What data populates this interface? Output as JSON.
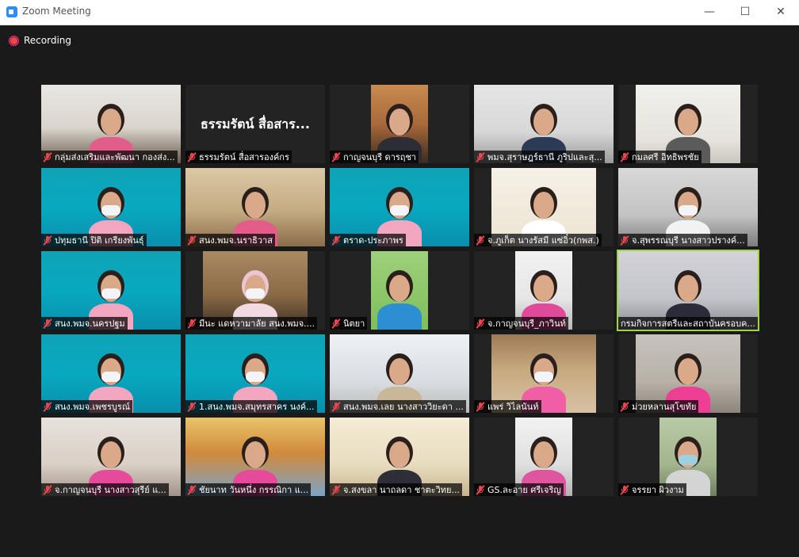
{
  "window": {
    "title": "Zoom Meeting",
    "minimize_glyph": "—",
    "maximize_glyph": "☐",
    "close_glyph": "✕"
  },
  "recording": {
    "label": "Recording",
    "indicator_color": "#e8474d"
  },
  "colors": {
    "background": "#1a1a1a",
    "muted_mic": "#e8474d",
    "active_speaker_border": "#9fd34b",
    "zoom_blue": "#2d8cff"
  },
  "participants": [
    {
      "name": "กลุ่มส่งเสริมและพัฒนา กองส่ง...",
      "muted": true,
      "video": "office-group"
    },
    {
      "name": "ธรรมรัตน์ สื่อสารองค์กร",
      "muted": true,
      "video": "none",
      "display_name": "ธรรมรัตน์ สื่อสาร..."
    },
    {
      "name": "กาญจนบุรี ดารฤชา",
      "muted": true,
      "video": "woman-room"
    },
    {
      "name": "พมจ.สุราษฎร์ธานี ภูริปและสุ...",
      "muted": true,
      "video": "man-office"
    },
    {
      "name": "กมลศรี อิทธิพรชัย",
      "muted": true,
      "video": "woman-desk"
    },
    {
      "name": "ปทุมธานี ปิติ เกรียงพันธุ์",
      "muted": true,
      "video": "teal-background"
    },
    {
      "name": "สนง.พมจ.นราธิวาส",
      "muted": true,
      "video": "meeting-room"
    },
    {
      "name": "ตราด-ประภาพร",
      "muted": true,
      "video": "teal-background"
    },
    {
      "name": "จ.ภูเก็ต นางรัสมี แซ่อิ๋ว(กพส.)",
      "muted": true,
      "video": "woman-white"
    },
    {
      "name": "จ.สุพรรณบุรี นางสาวปรางค์...",
      "muted": true,
      "video": "woman-office"
    },
    {
      "name": "สนง.พมจ.นครปฐม",
      "muted": true,
      "video": "teal-background"
    },
    {
      "name": "มีนะ แดหวามาลัย สนง.พมจ....",
      "muted": true,
      "video": "woman-hijab"
    },
    {
      "name": "นิตยา",
      "muted": true,
      "video": "man-shirt"
    },
    {
      "name": "จ.กาญจนบุรี_ภาวินท์",
      "muted": true,
      "video": "man-pink"
    },
    {
      "name": "กรมกิจการสตรีและสถาบันครอบค...",
      "muted": false,
      "video": "hall",
      "active": true
    },
    {
      "name": "สนง.พมจ.เพชรบูรณ์",
      "muted": true,
      "video": "teal-background"
    },
    {
      "name": "1.สนง.พมจ.สมุทรสาคร นงค์...",
      "muted": true,
      "video": "teal-background"
    },
    {
      "name": "สนง.พมจ.เลย นางสาววิยะดา ...",
      "muted": true,
      "video": "room-wall"
    },
    {
      "name": "แพร่ วิไลนันท์",
      "muted": true,
      "video": "woman-library"
    },
    {
      "name": "ม่วยหลานสุโขทัย",
      "muted": true,
      "video": "woman-glasses"
    },
    {
      "name": "จ.กาญจนบุรี นางสาวสุรีย์ แ...",
      "muted": true,
      "video": "women-office"
    },
    {
      "name": "ชัยนาท วันหนึ่ง กรรณิกา แ...",
      "muted": true,
      "video": "mural"
    },
    {
      "name": "จ.สงขลา นาถลดา ชาตะวิทย...",
      "muted": true,
      "video": "woman-flowers"
    },
    {
      "name": "GS.ละอาย ศรีเจริญ",
      "muted": true,
      "video": "woman-door"
    },
    {
      "name": "จรรยา ผิวงาม",
      "muted": true,
      "video": "woman-outdoor"
    }
  ]
}
